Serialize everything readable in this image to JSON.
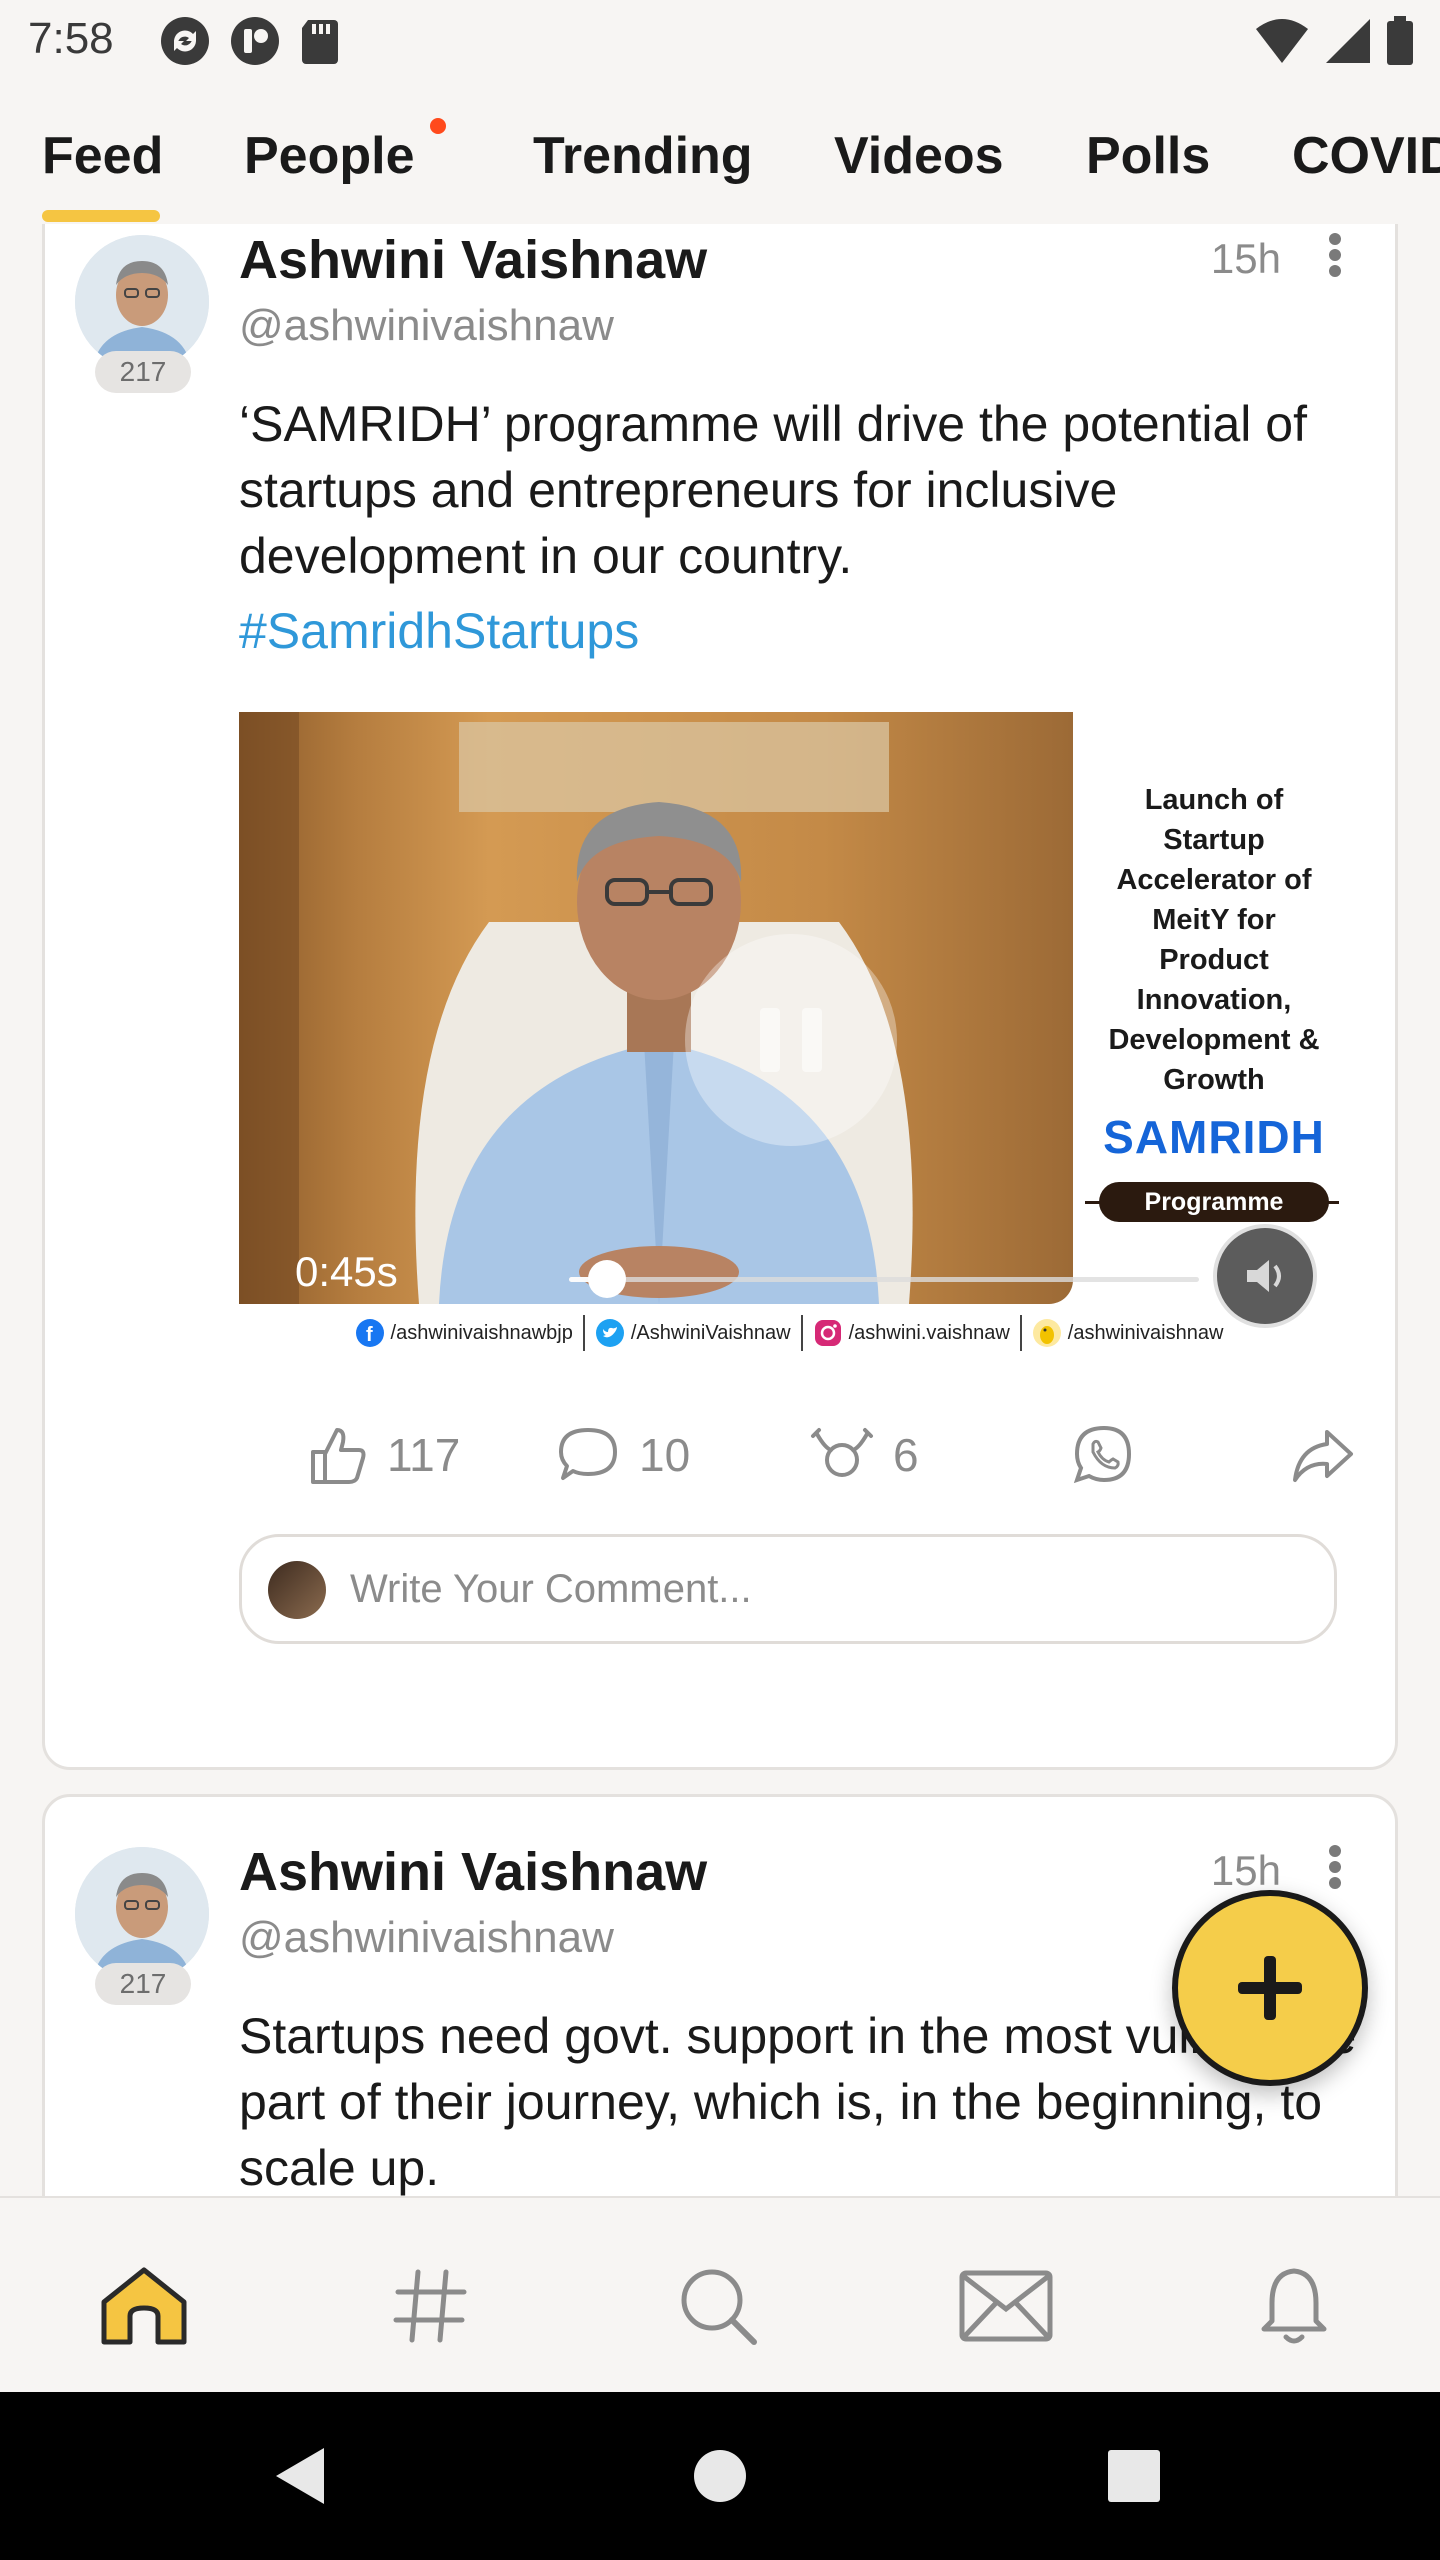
{
  "status_bar": {
    "time": "7:58",
    "left_icons": [
      "sync-icon",
      "app-icon",
      "sd-card-icon"
    ],
    "right_icons": [
      "wifi-icon",
      "cell-signal-icon",
      "battery-icon"
    ]
  },
  "tabs": [
    {
      "label": "Feed",
      "active": true
    },
    {
      "label": "People",
      "has_notification_dot": true
    },
    {
      "label": "Trending"
    },
    {
      "label": "Videos"
    },
    {
      "label": "Polls"
    },
    {
      "label": "COVID"
    }
  ],
  "posts": [
    {
      "author_name": "Ashwini Vaishnaw",
      "handle": "@ashwinivaishnaw",
      "followers_badge": "217",
      "time": "15h",
      "text": "‘SAMRIDH’ programme will drive the potential of startups and entrepreneurs for inclusive development in our country.",
      "hashtag": "#SamridhStartups",
      "video": {
        "elapsed": "0:45s",
        "progress": 0.06,
        "panel_lines": [
          "Launch of",
          "Startup",
          "Accelerator of",
          "MeitY for",
          "Product",
          "Innovation,",
          "Development &",
          "Growth"
        ],
        "panel_brand": "SAMRIDH",
        "panel_pill": "Programme",
        "social_links": [
          {
            "icon": "facebook-icon",
            "label": "/ashwinivaishnawbjp",
            "color": "#1877f2"
          },
          {
            "icon": "twitter-icon",
            "label": "/AshwiniVaishnaw",
            "color": "#1da1f2"
          },
          {
            "icon": "instagram-icon",
            "label": "/ashwini.vaishnaw",
            "color": "#d62976"
          },
          {
            "icon": "koo-icon",
            "label": "/ashwinivaishnaw",
            "color": "#f2c200"
          }
        ]
      },
      "likes": "117",
      "comments": "10",
      "rekoos": "6",
      "comment_placeholder": "Write Your Comment..."
    },
    {
      "author_name": "Ashwini Vaishnaw",
      "handle": "@ashwinivaishnaw",
      "followers_badge": "217",
      "time": "15h",
      "text": "Startups need govt. support in the most vulnerable part of their journey, which is, in the beginning, to scale up."
    }
  ],
  "bottom_nav": [
    "home-icon",
    "hashtag-icon",
    "search-icon",
    "mail-icon",
    "bell-icon"
  ],
  "colors": {
    "accent": "#f5c542",
    "hashtag": "#2f98d9",
    "notification_dot": "#ff4a1c",
    "brand_blue": "#1565d8"
  }
}
